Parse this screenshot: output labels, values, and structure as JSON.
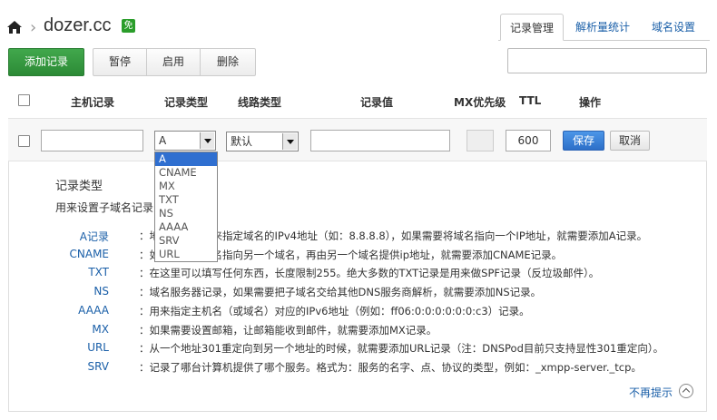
{
  "header": {
    "domain": "dozer.cc",
    "badge": "免",
    "separator": "›"
  },
  "tabs": [
    {
      "label": "记录管理",
      "active": true
    },
    {
      "label": "解析量统计",
      "active": false
    },
    {
      "label": "域名设置",
      "active": false
    }
  ],
  "toolbar": {
    "add_label": "添加记录",
    "pause_label": "暂停",
    "enable_label": "启用",
    "delete_label": "删除",
    "search_value": ""
  },
  "columns": {
    "host": "主机记录",
    "type": "记录类型",
    "line": "线路类型",
    "value": "记录值",
    "mx": "MX优先级",
    "ttl": "TTL",
    "ops": "操作"
  },
  "edit_row": {
    "host_value": "",
    "type_value": "A",
    "line_value": "默认",
    "record_value": "",
    "mx_value": "",
    "ttl_value": "600",
    "save_label": "保存",
    "cancel_label": "取消"
  },
  "type_options": [
    "A",
    "CNAME",
    "MX",
    "TXT",
    "NS",
    "AAAA",
    "SRV",
    "URL"
  ],
  "info": {
    "title": "记录类型",
    "subtitle": "用来设置子域名记录",
    "records": [
      {
        "type": "A记录",
        "desc": "：地址记录，用来指定域名的IPv4地址（如：8.8.8.8），如果需要将域名指向一个IP地址，就需要添加A记录。"
      },
      {
        "type": "CNAME",
        "desc": "：如果需要将域名指向另一个域名，再由另一个域名提供ip地址，就需要添加CNAME记录。"
      },
      {
        "type": "TXT",
        "desc": "：在这里可以填写任何东西，长度限制255。绝大多数的TXT记录是用来做SPF记录（反垃圾邮件）。"
      },
      {
        "type": "NS",
        "desc": "：域名服务器记录，如果需要把子域名交给其他DNS服务商解析，就需要添加NS记录。"
      },
      {
        "type": "AAAA",
        "desc": "：用来指定主机名（或域名）对应的IPv6地址（例如：ff06:0:0:0:0:0:0:c3）记录。"
      },
      {
        "type": "MX",
        "desc": "：如果需要设置邮箱，让邮箱能收到邮件，就需要添加MX记录。"
      },
      {
        "type": "URL",
        "desc": "：从一个地址301重定向到另一个地址的时候，就需要添加URL记录（注：DNSPod目前只支持显性301重定向）。"
      },
      {
        "type": "SRV",
        "desc": "：记录了哪台计算机提供了哪个服务。格式为：服务的名字、点、协议的类型，例如：_xmpp-server._tcp。"
      }
    ],
    "dismiss_label": "不再提示"
  },
  "colors": {
    "accent_green": "#2c8a36",
    "accent_blue": "#2d6fc8",
    "link_blue": "#1a5fa8"
  }
}
